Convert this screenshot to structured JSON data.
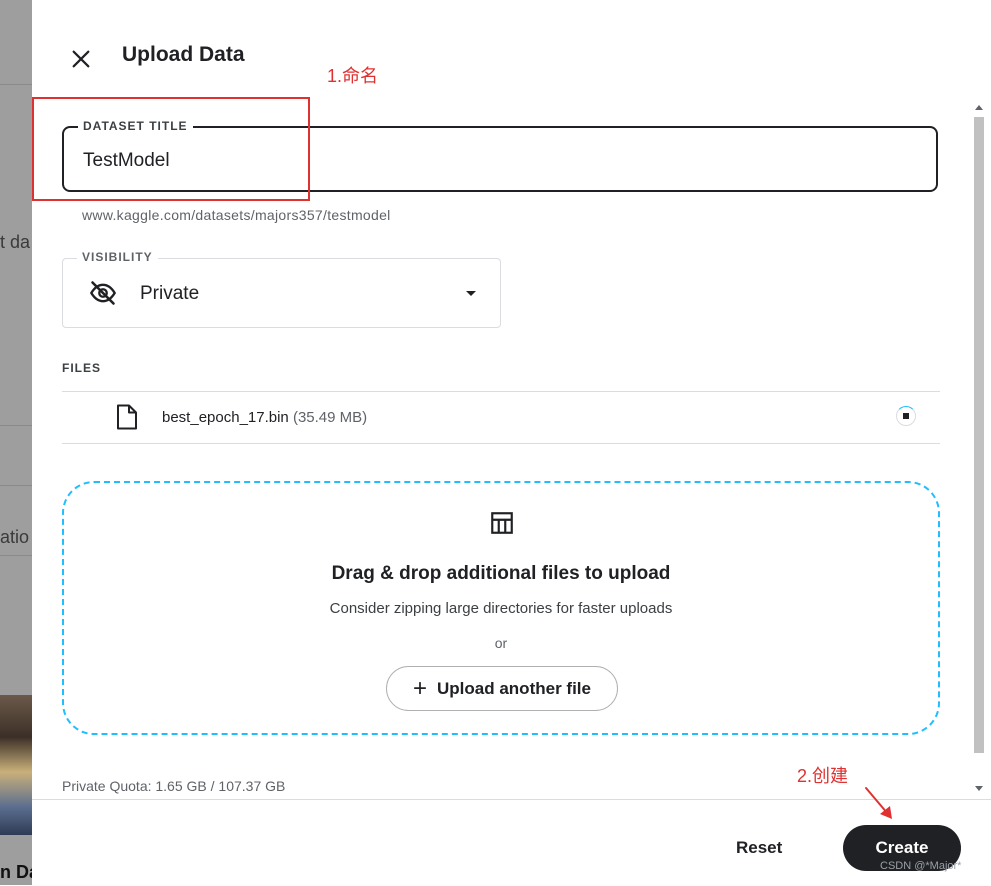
{
  "background": {
    "fragments": [
      "t da",
      "atio",
      "n Da"
    ]
  },
  "drawer": {
    "title": "Upload Data",
    "title_field": {
      "legend": "DATASET TITLE",
      "value": "TestModel",
      "url_hint": "www.kaggle.com/datasets/majors357/testmodel"
    },
    "visibility": {
      "legend": "VISIBILITY",
      "value": "Private",
      "icon": "eye-off-icon"
    },
    "files": {
      "label": "FILES",
      "items": [
        {
          "name": "best_epoch_17.bin",
          "size": "(35.49 MB)",
          "icon": "file-icon"
        }
      ]
    },
    "dropzone": {
      "icon": "table-icon",
      "heading": "Drag & drop additional files to upload",
      "subtext": "Consider zipping large directories for faster uploads",
      "or": "or",
      "button_label": "Upload another file"
    },
    "quota": "Private Quota: 1.65 GB / 107.37 GB",
    "footer": {
      "reset_label": "Reset",
      "create_label": "Create"
    }
  },
  "annotations": {
    "step1": "1.命名",
    "step2": "2.创建",
    "color": "#e03131"
  },
  "watermark": "CSDN @*Major*",
  "colors": {
    "accent_dashed": "#20beff",
    "primary_button": "#202124"
  }
}
